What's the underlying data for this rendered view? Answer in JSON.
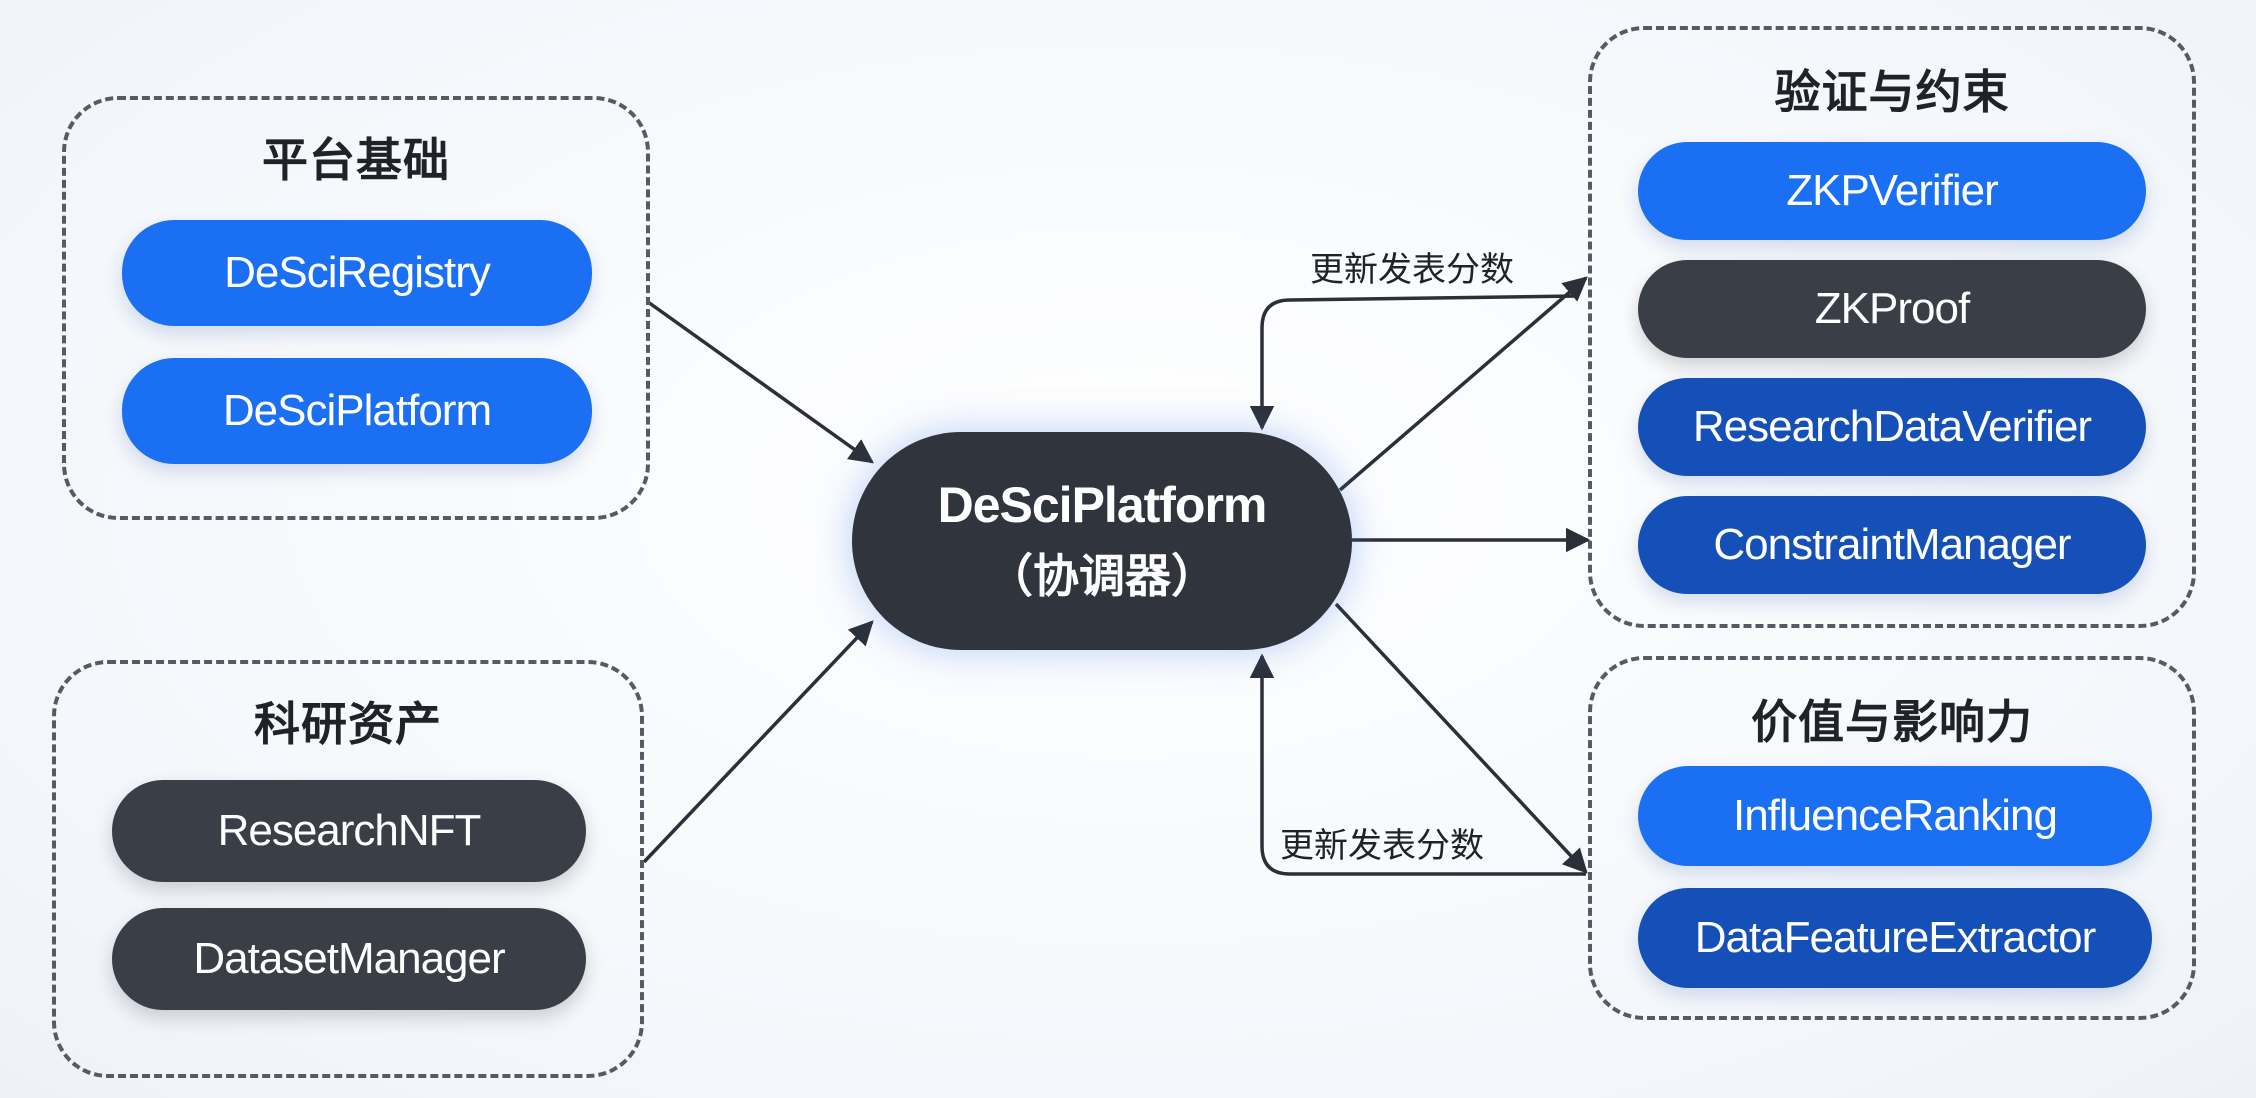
{
  "groups": {
    "platform": {
      "title": "平台基础",
      "items": [
        "DeSciRegistry",
        "DeSciPlatform"
      ]
    },
    "assets": {
      "title": "科研资产",
      "items": [
        "ResearchNFT",
        "DatasetManager"
      ]
    },
    "verify": {
      "title": "验证与约束",
      "items": [
        "ZKPVerifier",
        "ZKProof",
        "ResearchDataVerifier",
        "ConstraintManager"
      ]
    },
    "value": {
      "title": "价值与影响力",
      "items": [
        "InfluenceRanking",
        "DataFeatureExtractor"
      ]
    }
  },
  "center": {
    "name": "DeSciPlatform",
    "role": "（协调器）"
  },
  "edge_labels": {
    "top_loop": "更新发表分数",
    "bottom_loop": "更新发表分数"
  },
  "colors": {
    "bright_blue": "#1a6ff2",
    "navy_blue": "#1450b8",
    "dark_gray": "#3a3f47",
    "center_fill": "#30353d"
  }
}
